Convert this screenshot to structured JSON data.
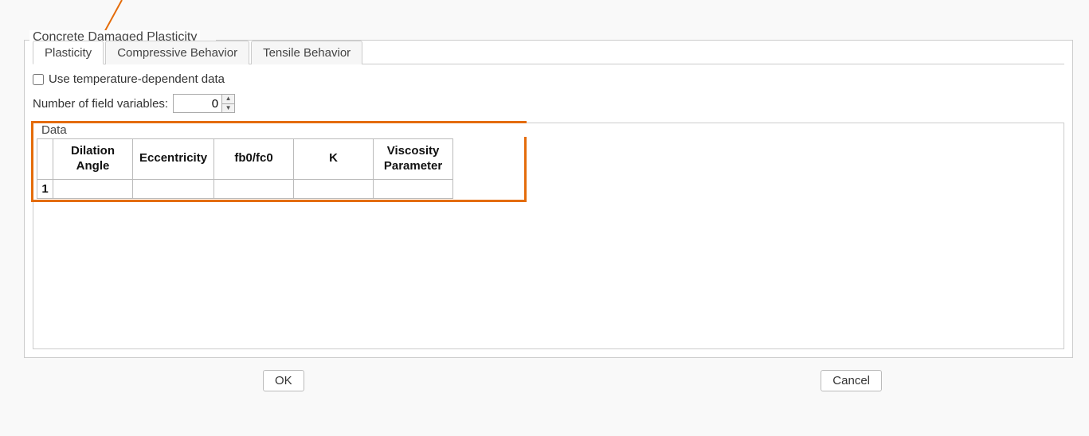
{
  "section_title": "Concrete Damaged Plasticity",
  "tabs": [
    "Plasticity",
    "Compressive Behavior",
    "Tensile Behavior"
  ],
  "active_tab_index": 0,
  "use_temp_data": {
    "label": "Use temperature-dependent data",
    "checked": false
  },
  "field_vars": {
    "label": "Number of field variables:",
    "value": "0"
  },
  "data_group": {
    "label": "Data",
    "headers": [
      "Dilation Angle",
      "Eccentricity",
      "fb0/fc0",
      "K",
      "Viscosity Parameter"
    ],
    "rows": [
      {
        "num": "1",
        "cells": [
          "",
          "",
          "",
          "",
          ""
        ]
      }
    ]
  },
  "buttons": {
    "ok": "OK",
    "cancel": "Cancel"
  },
  "annotation": {
    "color": "#e46c0a"
  }
}
